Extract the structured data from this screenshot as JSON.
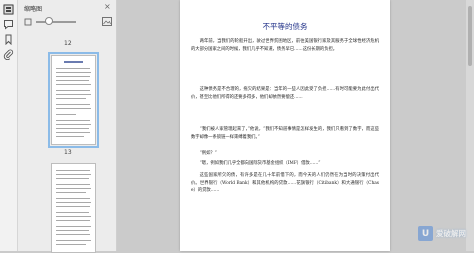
{
  "sidebar": {
    "title": "缩略图",
    "close": "×",
    "icons": [
      "thumbnail-icon",
      "comment-icon",
      "bookmark-icon",
      "attachment-icon"
    ]
  },
  "thumbnails": [
    {
      "page_label": "12",
      "selected": true
    },
    {
      "page_label": "13",
      "selected": false
    }
  ],
  "document": {
    "title": "不平等的债务",
    "paragraphs": [
      "两年前，当我们的轮船开出，驶过世界贫困地区，前往美国银行家及其服务于全球性经济危机的大部分国家之间的时候，我们几乎不知道，债务早已……这份长期的负担。",
      "这种债务是不合理的，拖欠的结果是：当年的一些人因此受了负担……有时可能要为此付出代价，甚至比他们所得的还要多得多，他们却依然要偿还……",
      "“我们被人家管理起来了，”他说，“我们不知道事情是怎样发生的，我们只看到了数字，而这些数字却像一条锁链一样束缚着我们。”",
      "“例如？”",
      "“嗯，例如我们几乎全都向国际货币基金组织（IMF）借款……”",
      "这些国家所欠的债，有许多是在几十年前借下的，而今天的人们仍然在为当时的决策付出代价。世界银行（World Bank）和其他机构的贷款……花旗银行（Citibank）和大通银行（Chase）的贷款……"
    ]
  },
  "watermark": {
    "logo": "U",
    "text": "爱破解网"
  }
}
